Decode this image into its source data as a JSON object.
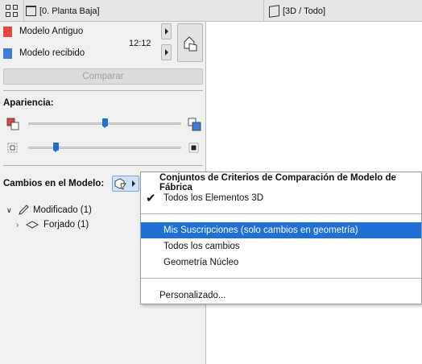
{
  "topbar": {
    "grid_icon": "grid-icon",
    "floor_plan_tab": "[0. Planta Baja]",
    "view_3d_tab": "[3D / Todo]"
  },
  "models": {
    "old_label": "Modelo Antiguo",
    "old_color": "#e8453c",
    "received_label": "Modelo recibido",
    "received_color": "#3b7ddd",
    "time": "12:12"
  },
  "compare_button": "Comparar",
  "appearance": {
    "title": "Apariencia:",
    "slider1_value": 0.5,
    "slider2_value": 0.18
  },
  "changes": {
    "title": "Cambios en el Modelo:",
    "tree": [
      {
        "label": "Modificado (1)"
      },
      {
        "label": "Forjado (1)"
      }
    ]
  },
  "menu": {
    "header": "Conjuntos de Criterios de Comparación de Modelo de Fábrica",
    "item_all": "Todos los Elementos 3D",
    "item_subscriptions": "Mis Suscripciones (solo cambios en geometría)",
    "item_all_changes": "Todos los cambios",
    "item_core_geometry": "Geometría Núcleo",
    "item_custom": "Personalizado...",
    "highlight_color": "#1e70d6"
  }
}
